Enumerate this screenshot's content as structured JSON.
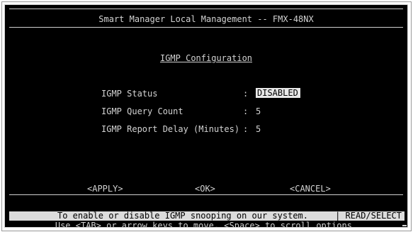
{
  "header": {
    "title": "Smart Manager Local Management -- FMX-48NX"
  },
  "page": {
    "section_title": "IGMP Configuration"
  },
  "fields": [
    {
      "label": "IGMP Status",
      "value": "DISABLED"
    },
    {
      "label": "IGMP Query Count",
      "value": "5"
    },
    {
      "label": "IGMP Report Delay (Minutes)",
      "value": "5"
    }
  ],
  "separator": ":",
  "buttons": {
    "apply": "<APPLY>",
    "ok": "<OK>",
    "cancel": "<CANCEL>"
  },
  "status_bar": {
    "help": "To enable or disable IGMP snooping on our system.",
    "mode": "| READ/SELECT"
  },
  "hint": "Use <TAB> or arrow keys to move, <Space> to scroll options.",
  "colors": {
    "background": "#000000",
    "foreground": "#d2d2d2",
    "highlight": "#e8e8e8"
  }
}
